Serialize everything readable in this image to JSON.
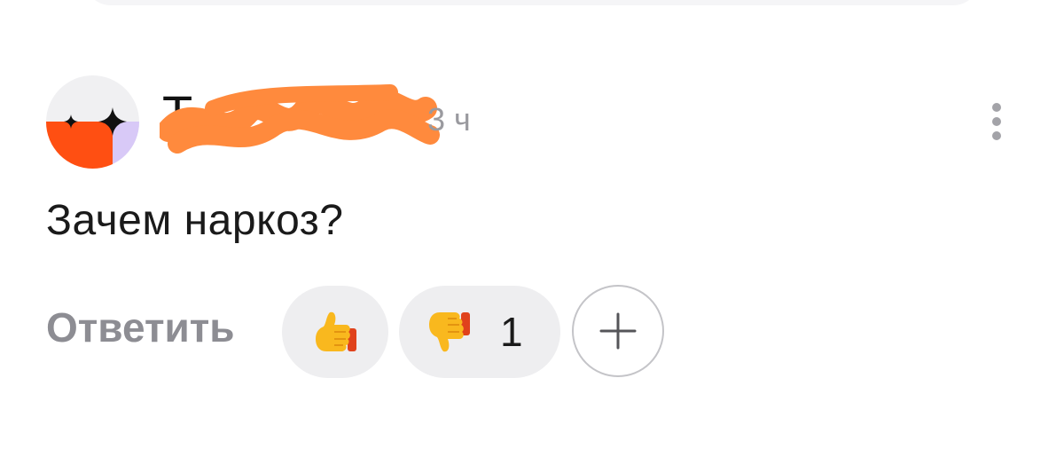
{
  "comment": {
    "author_name": "Т",
    "timestamp": "3 ч",
    "text": "Зачем наркоз?"
  },
  "actions": {
    "reply_label": "Ответить",
    "reactions": [
      {
        "icon": "thumbs-up-icon",
        "count": ""
      },
      {
        "icon": "thumbs-down-icon",
        "count": "1"
      }
    ],
    "add_reaction_icon": "plus-icon",
    "more_icon": "more-vertical-icon"
  },
  "colors": {
    "avatar_orange": "#ff4f12",
    "avatar_lavender": "#d8c9f7",
    "redaction_orange": "#ff8a3d",
    "chip_background": "#eeeef0",
    "muted_text": "#8d8d93"
  }
}
